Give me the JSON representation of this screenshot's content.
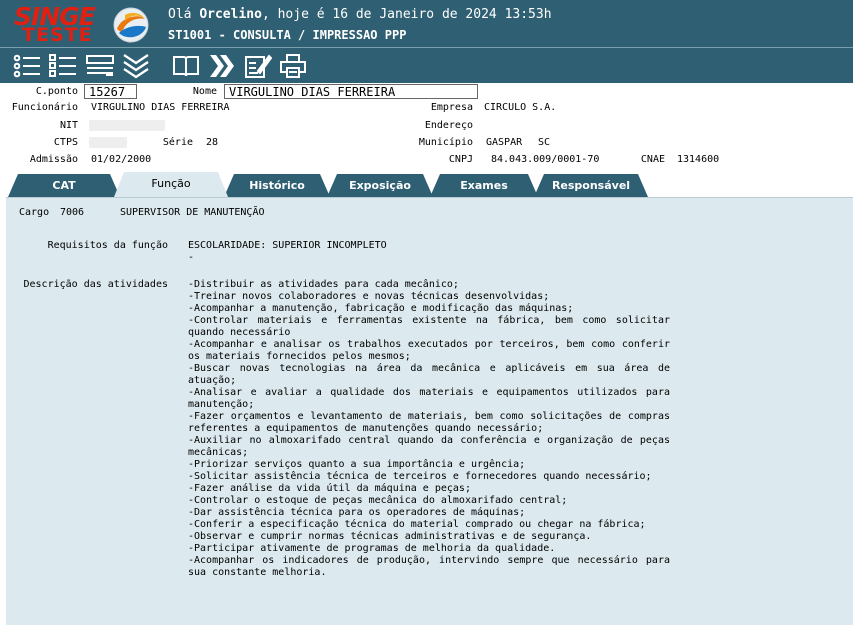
{
  "header": {
    "logo_top": "SINGE",
    "logo_bottom": "TESTE",
    "greeting_prefix": "Olá ",
    "user_name": "Orcelino",
    "greeting_suffix": ", hoje é 16 de Janeiro de 2024 13:53h",
    "screen_title": "ST1001 - CONSULTA / IMPRESSAO PPP"
  },
  "toolbar": {
    "icons": [
      "list-icon",
      "list-check-icon",
      "form-icon",
      "collapse-icon",
      "book-icon",
      "next-icon",
      "edit-icon",
      "print-icon"
    ]
  },
  "employee": {
    "cponto_label": "C.ponto",
    "cponto_value": "15267",
    "nome_label": "Nome",
    "nome_value": "VIRGULINO DIAS FERREIRA",
    "funcionario_label": "Funcionário",
    "funcionario_value": "VIRGULINO DIAS FERREIRA",
    "nit_label": "NIT",
    "ctps_label": "CTPS",
    "serie_label": "Série",
    "serie_value": "28",
    "admissao_label": "Admissão",
    "admissao_value": "01/02/2000",
    "empresa_label": "Empresa",
    "empresa_value": "CIRCULO S.A.",
    "endereco_label": "Endereço",
    "municipio_label": "Município",
    "municipio_value": "GASPAR",
    "uf_value": "SC",
    "cnpj_label": "CNPJ",
    "cnpj_value": "84.043.009/0001-70",
    "cnae_label": "CNAE",
    "cnae_value": "1314600"
  },
  "tabs": [
    {
      "label": "CAT"
    },
    {
      "label": "Função",
      "active": true
    },
    {
      "label": "Histórico"
    },
    {
      "label": "Exposição"
    },
    {
      "label": "Exames"
    },
    {
      "label": "Responsável"
    }
  ],
  "funcao": {
    "cargo_label": "Cargo",
    "cargo_code": "7006",
    "cargo_name": "SUPERVISOR DE MANUTENÇÃO",
    "requisitos_label": "Requisitos da função",
    "requisitos_line1": "ESCOLARIDADE: SUPERIOR INCOMPLETO",
    "requisitos_line2": "-",
    "descricao_label": "Descrição das atividades",
    "atividades": [
      "-Distribuir as atividades para cada mecânico;",
      "-Treinar novos colaboradores e novas técnicas desenvolvidas;",
      "-Acompanhar a manutenção, fabricação e modificação das máquinas;",
      "-Controlar materiais e ferramentas existente na fábrica, bem como solicitar quando necessário",
      "-Acompanhar e analisar os trabalhos executados por terceiros, bem como conferir os materiais fornecidos pelos mesmos;",
      "-Buscar novas tecnologias na área da mecânica e aplicáveis em sua área de atuação;",
      "-Analisar e avaliar a qualidade dos materiais e equipamentos utilizados para manutenção;",
      "-Fazer orçamentos e levantamento de materiais, bem como solicitações de compras referentes a equipamentos de manutenções quando necessário;",
      "-Auxiliar no almoxarifado central quando da conferência e organização de peças mecânicas;",
      "-Priorizar serviços quanto a sua importância e urgência;",
      "-Solicitar assistência técnica de terceiros e fornecedores quando necessário;",
      "-Fazer análise da vida útil da máquina e peças;",
      "-Controlar o estoque de peças mecânica do almoxarifado central;",
      "-Dar assistência técnica para os operadores de máquinas;",
      "-Conferir a especificação técnica do material comprado ou chegar na fábrica;",
      "-Observar e cumprir normas técnicas administrativas e de segurança.",
      "-Participar ativamente de programas de melhoria da qualidade.",
      "-Acompanhar os indicadores de produção, intervindo sempre que necessário para sua constante melhoria."
    ]
  }
}
